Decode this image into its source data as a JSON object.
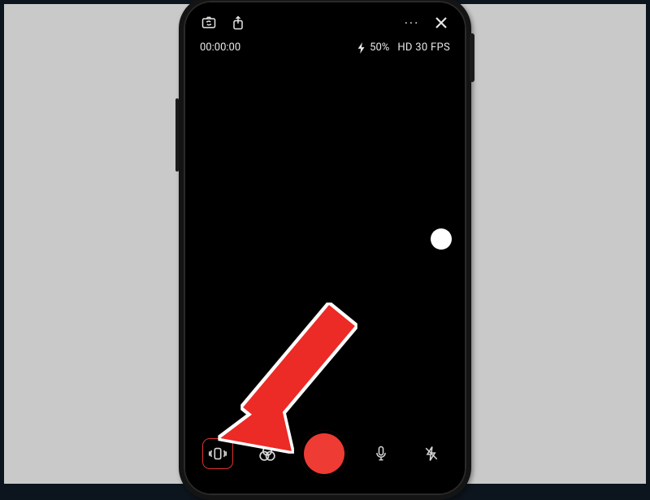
{
  "top": {
    "camera_flip_icon": "camera-flip-icon",
    "share_icon": "share-icon",
    "more_icon": "more-icon",
    "more_label": "···",
    "close_icon": "close-icon"
  },
  "info": {
    "timer": "00:00:00",
    "flash_pct": "50%",
    "resolution": "HD 30 FPS"
  },
  "focus": {
    "dot": "focus-point"
  },
  "bottom": {
    "stabilize_icon": "stabilize-icon",
    "filters_icon": "filters-icon",
    "record_icon": "record-button",
    "mic_icon": "mic-icon",
    "flash_off_icon": "flash-off-icon"
  },
  "annotation": {
    "arrow": "tutorial-arrow"
  },
  "colors": {
    "accent_red": "#ee3b33",
    "highlight": "#e0332f"
  }
}
